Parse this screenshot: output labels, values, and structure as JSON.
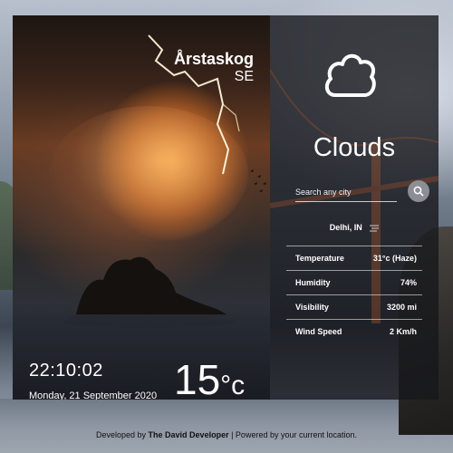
{
  "location": {
    "city": "Årstaskog",
    "country": "SE"
  },
  "time": {
    "clock": "22:10:02",
    "date": "Monday, 21 September 2020"
  },
  "temperature": {
    "value": "15",
    "unit": "°c"
  },
  "weather": {
    "condition": "Clouds",
    "icon": "cloud-icon"
  },
  "search": {
    "placeholder": "Search any city",
    "icon": "search-icon"
  },
  "place": {
    "label": "Delhi, IN",
    "icon": "haze-icon"
  },
  "details": [
    {
      "label": "Temperature",
      "value": "31°c (Haze)"
    },
    {
      "label": "Humidity",
      "value": "74%"
    },
    {
      "label": "Visibility",
      "value": "3200 mi"
    },
    {
      "label": "Wind Speed",
      "value": "2 Km/h"
    }
  ],
  "footer": {
    "prefix": "Developed by",
    "author": "The David Developer",
    "suffix": "| Powered by your current location."
  }
}
